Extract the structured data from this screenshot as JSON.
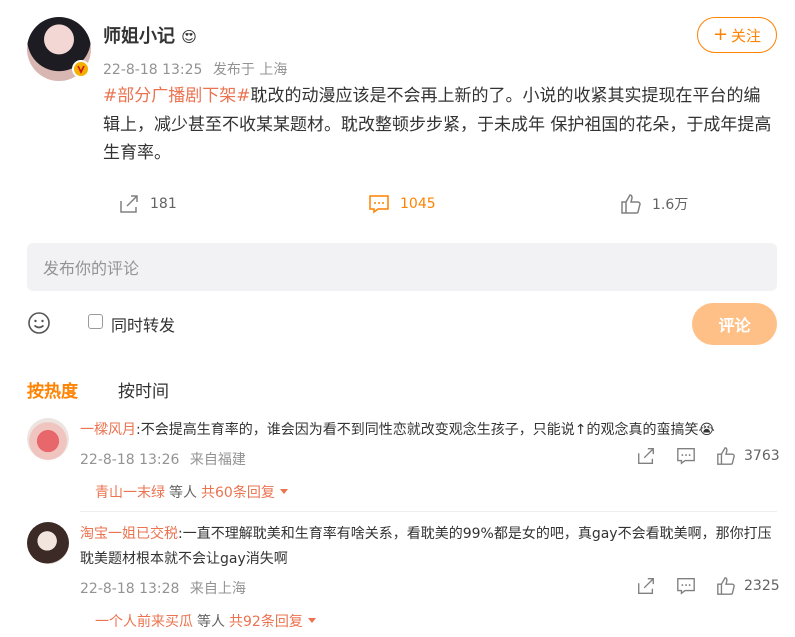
{
  "post": {
    "author": "师姐小记",
    "author_emoji": "😍",
    "time": "22-8-18 13:25",
    "source": "发布于 上海",
    "follow_label": "关注",
    "hashtag": "#部分广播剧下架#",
    "body": "耽改的动漫应该是不会再上新的了。小说的收紧其实提现在平台的编辑上，减少甚至不收某某题材。耽改整顿步步紧，于未成年 保护祖国的花朵，于成年提高生育率。",
    "reposts": "181",
    "comments": "1045",
    "likes": "1.6万"
  },
  "composer": {
    "placeholder": "发布你的评论",
    "repost_checkbox_label": "同时转发",
    "submit_label": "评论"
  },
  "sort_tabs": {
    "hot": "按热度",
    "time": "按时间"
  },
  "comments": [
    {
      "user": "一樑风月",
      "text": ":不会提高生育率的，谁会因为看不到同性恋就改变观念生孩子，只能说↑的观念真的蛮搞笑",
      "emoji": "😭",
      "time": "22-8-18 13:26",
      "location": "来自福建",
      "likes": "3763",
      "reply_user": "青山一末绿",
      "reply_mid": "等人",
      "reply_count": "共60条回复"
    },
    {
      "user": "淘宝一姐已交税",
      "text": ":一直不理解耽美和生育率有啥关系，看耽美的99%都是女的吧，真gay不会看耽美啊，那你打压耽美题材根本就不会让gay消失啊",
      "time": "22-8-18 13:28",
      "location": "来自上海",
      "likes": "2325",
      "reply_user": "一个人前来买瓜",
      "reply_mid": "等人",
      "reply_count": "共92条回复"
    }
  ],
  "colors": {
    "accent": "#ff8200",
    "link": "#eb7350",
    "muted": "#939393",
    "input_bg": "#f2f2f5",
    "submit_disabled": "#ffc087"
  }
}
